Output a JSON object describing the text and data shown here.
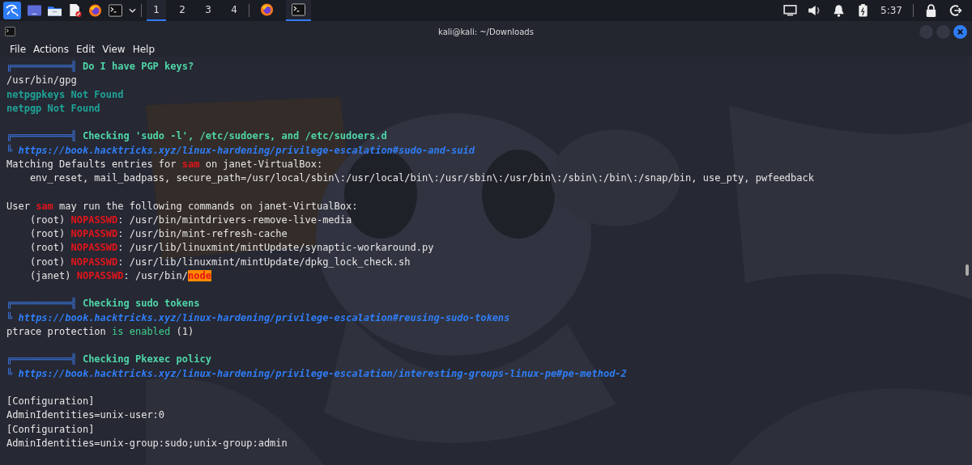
{
  "taskbar": {
    "launchers": [
      {
        "kind": "menu"
      },
      {
        "kind": "desktop"
      },
      {
        "kind": "files"
      },
      {
        "kind": "editor"
      },
      {
        "kind": "browser"
      },
      {
        "kind": "terminal"
      },
      {
        "kind": "caret"
      }
    ],
    "workspaces": [
      {
        "label": "1",
        "selected": true
      },
      {
        "label": "2",
        "selected": false
      },
      {
        "label": "3",
        "selected": false
      },
      {
        "label": "4",
        "selected": false
      }
    ],
    "tasks": [
      {
        "kind": "browser",
        "selected": false
      },
      {
        "kind": "terminal",
        "selected": true
      }
    ],
    "clock": "5:37"
  },
  "window": {
    "title": "kali@kali: ~/Downloads"
  },
  "menu": [
    "File",
    "Actions",
    "Edit",
    "View",
    "Help"
  ],
  "lines": [
    {
      "kind": "line",
      "spans": [
        {
          "kind": "frame",
          "text": "╔══════════╣ "
        },
        {
          "kind": "heading",
          "text": "Do I have PGP keys?"
        }
      ]
    },
    {
      "kind": "line",
      "spans": [
        {
          "kind": "output",
          "text": "/usr/bin/gpg"
        }
      ]
    },
    {
      "kind": "line",
      "spans": [
        {
          "kind": "notfound",
          "text": "netpgpkeys Not Found"
        }
      ]
    },
    {
      "kind": "line",
      "spans": [
        {
          "kind": "notfound",
          "text": "netpgp Not Found"
        }
      ]
    },
    {
      "kind": "blank"
    },
    {
      "kind": "line",
      "spans": [
        {
          "kind": "frame",
          "text": "╔══════════╣ "
        },
        {
          "kind": "heading",
          "text": "Checking 'sudo -l', /etc/sudoers, and /etc/sudoers.d"
        }
      ]
    },
    {
      "kind": "line",
      "spans": [
        {
          "kind": "frame",
          "text": "╚ "
        },
        {
          "kind": "link",
          "text": "https://book.hacktricks.xyz/linux-hardening/privilege-escalation#sudo-and-suid"
        }
      ]
    },
    {
      "kind": "line",
      "spans": [
        {
          "kind": "output",
          "text": "Matching Defaults entries for "
        },
        {
          "kind": "user",
          "text": "sam"
        },
        {
          "kind": "output",
          "text": " on janet-VirtualBox:"
        }
      ]
    },
    {
      "kind": "line",
      "spans": [
        {
          "kind": "output",
          "text": "    env_reset, mail_badpass, secure_path=/usr/local/sbin\\:/usr/local/bin\\:/usr/sbin\\:/usr/bin\\:/sbin\\:/bin\\:/snap/bin, use_pty, pwfeedback"
        }
      ]
    },
    {
      "kind": "blank"
    },
    {
      "kind": "line",
      "spans": [
        {
          "kind": "output",
          "text": "User "
        },
        {
          "kind": "user",
          "text": "sam"
        },
        {
          "kind": "output",
          "text": " may run the following commands on janet-VirtualBox:"
        }
      ]
    },
    {
      "kind": "line",
      "spans": [
        {
          "kind": "output",
          "text": "    (root) "
        },
        {
          "kind": "user",
          "text": "NOPASSWD"
        },
        {
          "kind": "output",
          "text": ": /usr/bin/mintdrivers-remove-live-media"
        }
      ]
    },
    {
      "kind": "line",
      "spans": [
        {
          "kind": "output",
          "text": "    (root) "
        },
        {
          "kind": "user",
          "text": "NOPASSWD"
        },
        {
          "kind": "output",
          "text": ": /usr/bin/mint-refresh-cache"
        }
      ]
    },
    {
      "kind": "line",
      "spans": [
        {
          "kind": "output",
          "text": "    (root) "
        },
        {
          "kind": "user",
          "text": "NOPASSWD"
        },
        {
          "kind": "output",
          "text": ": /usr/lib/linuxmint/mintUpdate/synaptic-workaround.py"
        }
      ]
    },
    {
      "kind": "line",
      "spans": [
        {
          "kind": "output",
          "text": "    (root) "
        },
        {
          "kind": "user",
          "text": "NOPASSWD"
        },
        {
          "kind": "output",
          "text": ": /usr/lib/linuxmint/mintUpdate/dpkg_lock_check.sh"
        }
      ]
    },
    {
      "kind": "line",
      "spans": [
        {
          "kind": "output",
          "text": "    (janet) "
        },
        {
          "kind": "user",
          "text": "NOPASSWD"
        },
        {
          "kind": "output",
          "text": ": /usr/bin/"
        },
        {
          "kind": "match",
          "text": "node"
        }
      ]
    },
    {
      "kind": "blank"
    },
    {
      "kind": "line",
      "spans": [
        {
          "kind": "frame",
          "text": "╔══════════╣ "
        },
        {
          "kind": "heading",
          "text": "Checking sudo tokens"
        }
      ]
    },
    {
      "kind": "line",
      "spans": [
        {
          "kind": "frame",
          "text": "╚ "
        },
        {
          "kind": "link",
          "text": "https://book.hacktricks.xyz/linux-hardening/privilege-escalation#reusing-sudo-tokens"
        }
      ]
    },
    {
      "kind": "line",
      "spans": [
        {
          "kind": "output",
          "text": "ptrace protection "
        },
        {
          "kind": "enabled",
          "text": "is enabled"
        },
        {
          "kind": "output",
          "text": " (1)"
        }
      ]
    },
    {
      "kind": "blank"
    },
    {
      "kind": "line",
      "spans": [
        {
          "kind": "frame",
          "text": "╔══════════╣ "
        },
        {
          "kind": "heading",
          "text": "Checking Pkexec policy"
        }
      ]
    },
    {
      "kind": "line",
      "spans": [
        {
          "kind": "frame",
          "text": "╚ "
        },
        {
          "kind": "link",
          "text": "https://book.hacktricks.xyz/linux-hardening/privilege-escalation/interesting-groups-linux-pe#pe-method-2"
        }
      ]
    },
    {
      "kind": "blank"
    },
    {
      "kind": "line",
      "spans": [
        {
          "kind": "output",
          "text": "[Configuration]"
        }
      ]
    },
    {
      "kind": "line",
      "spans": [
        {
          "kind": "output",
          "text": "AdminIdentities=unix-user:0"
        }
      ]
    },
    {
      "kind": "line",
      "spans": [
        {
          "kind": "output",
          "text": "[Configuration]"
        }
      ]
    },
    {
      "kind": "line",
      "spans": [
        {
          "kind": "output",
          "text": "AdminIdentities=unix-group:sudo;unix-group:admin"
        }
      ]
    }
  ]
}
